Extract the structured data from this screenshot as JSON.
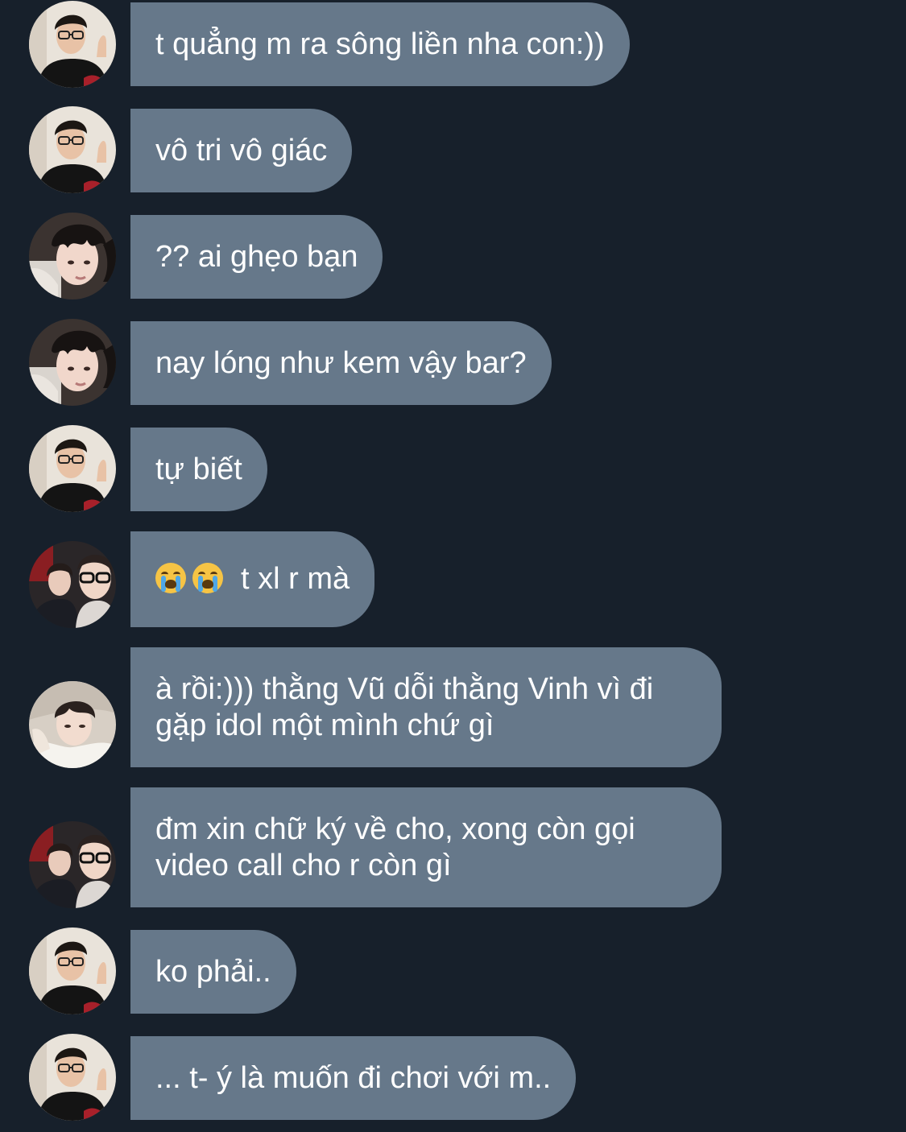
{
  "messages": [
    {
      "avatar": "guy-glasses-avatar",
      "text": "t quẳng m ra sông liền nha con:))"
    },
    {
      "avatar": "guy-glasses-avatar",
      "text": "vô tri vô giác"
    },
    {
      "avatar": "wet-hair-avatar",
      "text": "?? ai ghẹo bạn"
    },
    {
      "avatar": "wet-hair-avatar",
      "text": "nay lóng như kem vậy bar?"
    },
    {
      "avatar": "guy-glasses-avatar",
      "text": "tự biết"
    },
    {
      "avatar": "duo-selfie-avatar",
      "emoji": "😭 😭",
      "text": "t xl r mà"
    },
    {
      "avatar": "pillow-avatar",
      "text": "à rồi:))) thằng Vũ dỗi thằng Vinh vì đi gặp idol một mình chứ gì"
    },
    {
      "avatar": "duo-selfie-avatar",
      "text": "đm xin chữ ký về cho, xong còn gọi video call cho r còn gì"
    },
    {
      "avatar": "guy-glasses-avatar",
      "text": "ko phải.."
    },
    {
      "avatar": "guy-glasses-avatar",
      "text": "... t- ý là muốn đi chơi với m.."
    }
  ],
  "colors": {
    "background": "#17202b",
    "bubble": "#66788a",
    "text": "#ffffff"
  }
}
